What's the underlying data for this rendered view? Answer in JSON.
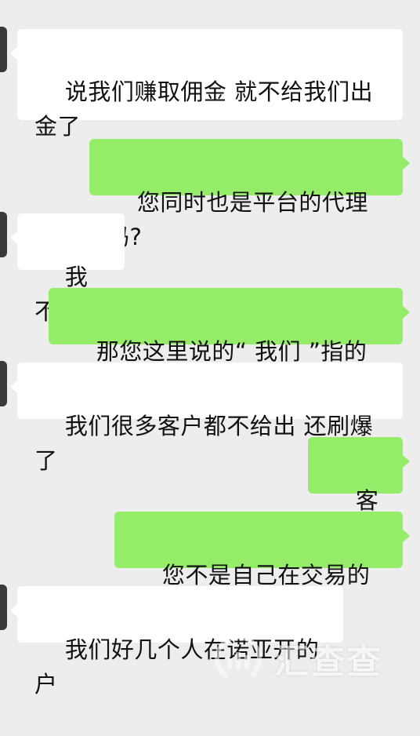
{
  "messages": [
    {
      "side": "left",
      "text": "说我们赚取佣金 就不给我们出金了"
    },
    {
      "side": "right",
      "text": "您同时也是平台的代理吗?"
    },
    {
      "side": "left",
      "text": "我不是"
    },
    {
      "side": "right",
      "text": "那您这里说的“ 我们 ”指的是?"
    },
    {
      "side": "left",
      "text": "我们很多客户都不给出 还刷爆了"
    },
    {
      "side": "right",
      "text": "客户?"
    },
    {
      "side": "right",
      "text": "您不是自己在交易的吗?"
    },
    {
      "side": "left",
      "text": "我们好几个人在诺亚开的户"
    }
  ],
  "watermark": {
    "text": "汇查查",
    "icon": "huichacha-logo-icon"
  },
  "colors": {
    "background": "#ededed",
    "incoming_bubble": "#ffffff",
    "outgoing_bubble": "#95ec69"
  }
}
